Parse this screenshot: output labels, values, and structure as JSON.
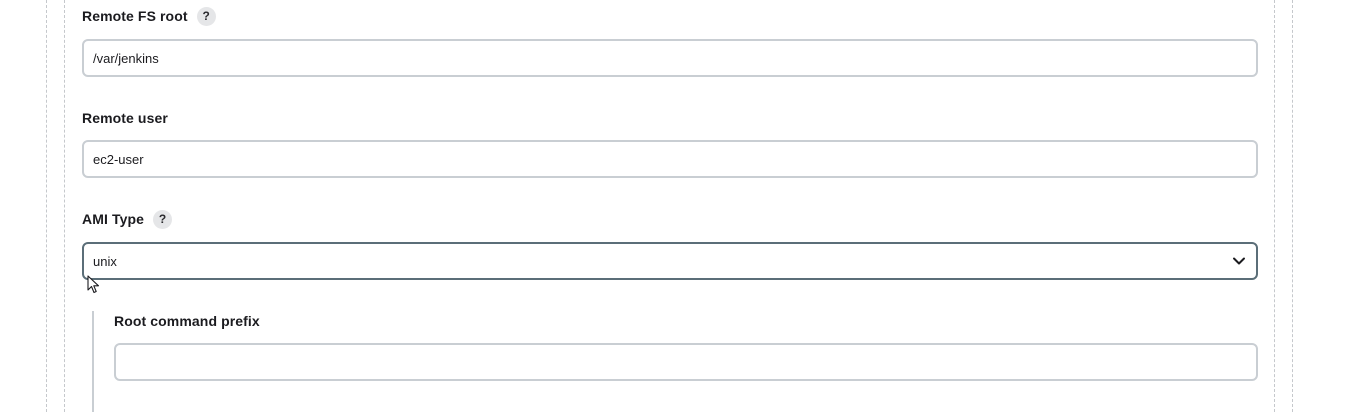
{
  "remote_fs_root": {
    "label": "Remote FS root",
    "help": "?",
    "value": "/var/jenkins"
  },
  "remote_user": {
    "label": "Remote user",
    "value": "ec2-user"
  },
  "ami_type": {
    "label": "AMI Type",
    "help": "?",
    "selected": "unix"
  },
  "root_command_prefix": {
    "label": "Root command prefix",
    "value": ""
  }
}
